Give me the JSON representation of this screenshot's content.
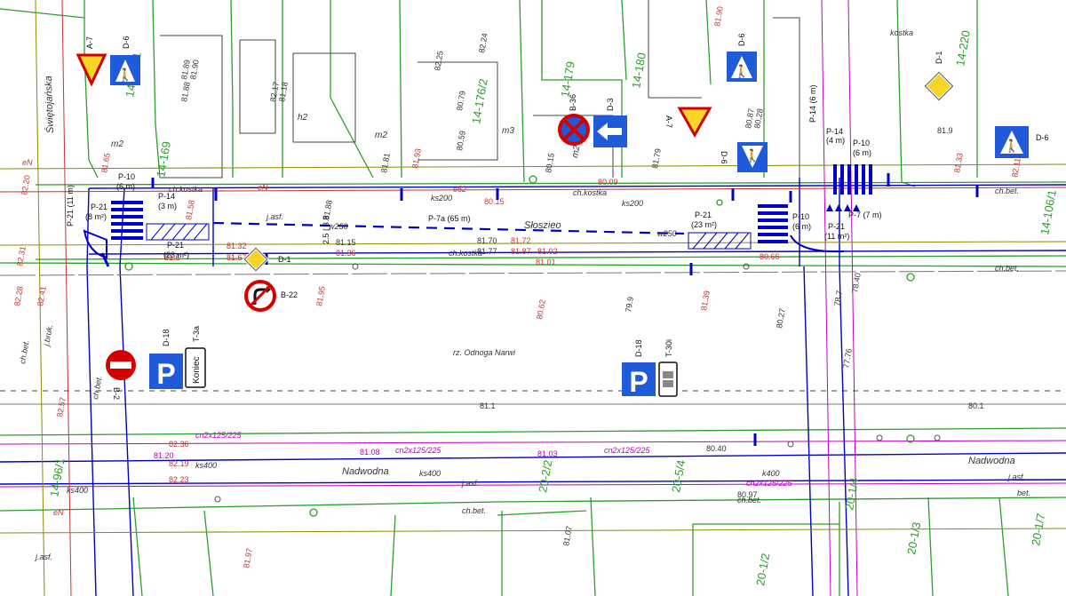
{
  "streets": {
    "main": "Słoszieo",
    "south": "Nadwodna",
    "west": "Świętojańska",
    "river_note": "rz. Odnoga Narwi"
  },
  "parcels": [
    "14-176/1",
    "14-176/2",
    "14-179",
    "14-180",
    "14-220",
    "14-169",
    "14-96/1",
    "20-2/2",
    "20-5/4",
    "20-1/2",
    "20-1/3",
    "20-1/4",
    "20-1/7",
    "14-106/1"
  ],
  "signs": {
    "a7_left": "A-7",
    "d6_left": "D-6",
    "b36": "B-36",
    "d3": "D-3",
    "a7_mid": "A-7",
    "d6_mid_top": "D-6",
    "d6_mid_rot": "D-6",
    "d1_right": "D-1",
    "d6_right": "D-6",
    "d1_center": "D-1",
    "b22": "B-22",
    "b2": "B-2",
    "d18_left": "D-18",
    "t3a": "T-3a",
    "koniec": "Koniec",
    "d18_mid": "D-18",
    "t30i": "T-30i"
  },
  "markings": {
    "p10_left": "P-10",
    "p10_left_len": "(6 m)",
    "p21_left": "P-21",
    "p21_left_area": "(8 m²)",
    "p14_left": "P-14",
    "p14_left_len": "(3 m)",
    "p21_left_bottom": "P-21",
    "p21_left_bottom_area": "(23 m²)",
    "p7a": "P-7a (65 m)",
    "p21_mid": "P-21",
    "p21_mid_area": "(23 m²)",
    "p10_right": "P-10",
    "p10_right_len": "(6 m)",
    "p21_right": "P-21",
    "p21_right_area": "(11 m²)",
    "p14_right": "P-14",
    "p14_right_len": "(4 m)",
    "p10_right_top": "P-10",
    "p10_right_top_len": "(6 m)",
    "p21_rot_left": "P-21 (11 m)",
    "p21_rot_right": "P-7 (7 m)",
    "dim": "2.5 | 3.8",
    "p14_right_mid": "P-14 (6 m)"
  },
  "elevations": [
    "81.72",
    "81.87",
    "82.20",
    "82.31",
    "82.28",
    "82.41",
    "82.57",
    "82.36",
    "82.19",
    "82.23",
    "81.20",
    "81.08",
    "81.03",
    "80.15",
    "80.09",
    "81.70",
    "81.77",
    "81.02",
    "81.01",
    "80.66",
    "80.62",
    "79.9",
    "78.7",
    "77.76",
    "78.40",
    "81.1",
    "80.1",
    "81.9",
    "81.33",
    "82.11",
    "81.15",
    "81.36",
    "81.67",
    "81.6",
    "81.32",
    "81.58",
    "81.88",
    "81.81",
    "81.65",
    "81.93",
    "81.88",
    "81.89",
    "81.90",
    "82.25",
    "82.24",
    "80.79",
    "80.59",
    "81.79",
    "80.15",
    "81.39",
    "80.27",
    "82.17",
    "81.18",
    "81.95",
    "80.97",
    "81.07",
    "80.40",
    "81.97",
    "81.90",
    "80.87",
    "80.28"
  ],
  "text_labels": {
    "ks400": "ks400",
    "ks200": "ks200",
    "w250": "w250",
    "cn": "cn2x125/225",
    "jasf": "j.asf.",
    "chbet": "ch.bet.",
    "chkostka": "ch.kostka",
    "bet": "bet.",
    "jbruk": "j.bruk.",
    "k400": "k400",
    "eN": "eN",
    "m2": "m2",
    "m3": "m3",
    "h2": "h2",
    "kostka": "kostka",
    "e52": "e52"
  },
  "colors": {
    "road": "#0000c8",
    "plot": "#28a028",
    "elevation": "#c83232",
    "gas": "#c000c0",
    "sign_blue": "#1f5bd8",
    "sign_yellow": "#f5d628",
    "sign_red": "#d40000"
  }
}
